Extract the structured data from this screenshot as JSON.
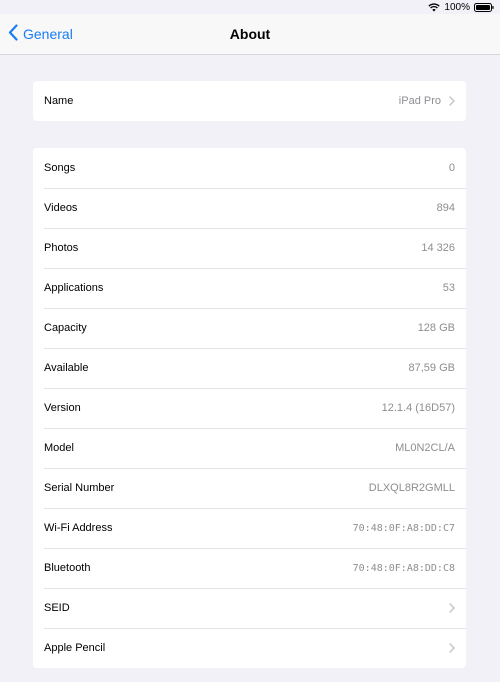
{
  "status": {
    "battery": "100%"
  },
  "nav": {
    "back_label": "General",
    "title": "About"
  },
  "name_group": {
    "label": "Name",
    "value": "iPad Pro"
  },
  "info": [
    {
      "label": "Songs",
      "value": "0"
    },
    {
      "label": "Videos",
      "value": "894"
    },
    {
      "label": "Photos",
      "value": "14 326"
    },
    {
      "label": "Applications",
      "value": "53"
    },
    {
      "label": "Capacity",
      "value": "128 GB"
    },
    {
      "label": "Available",
      "value": "87,59 GB"
    },
    {
      "label": "Version",
      "value": "12.1.4 (16D57)"
    },
    {
      "label": "Model",
      "value": "ML0N2CL/A"
    },
    {
      "label": "Serial Number",
      "value": "DLXQL8R2GMLL"
    },
    {
      "label": "Wi-Fi Address",
      "value": "70:48:0F:A8:DD:C7"
    },
    {
      "label": "Bluetooth",
      "value": "70:48:0F:A8:DD:C8"
    },
    {
      "label": "SEID",
      "value": ""
    },
    {
      "label": "Apple Pencil",
      "value": ""
    }
  ],
  "colors": {
    "accent": "#1a7cf5",
    "background": "#f2f1f7",
    "secondary_text": "#8e8e93"
  },
  "icons": [
    "wifi-icon",
    "battery-icon",
    "back-chevron-icon",
    "chevron-right-icon"
  ]
}
